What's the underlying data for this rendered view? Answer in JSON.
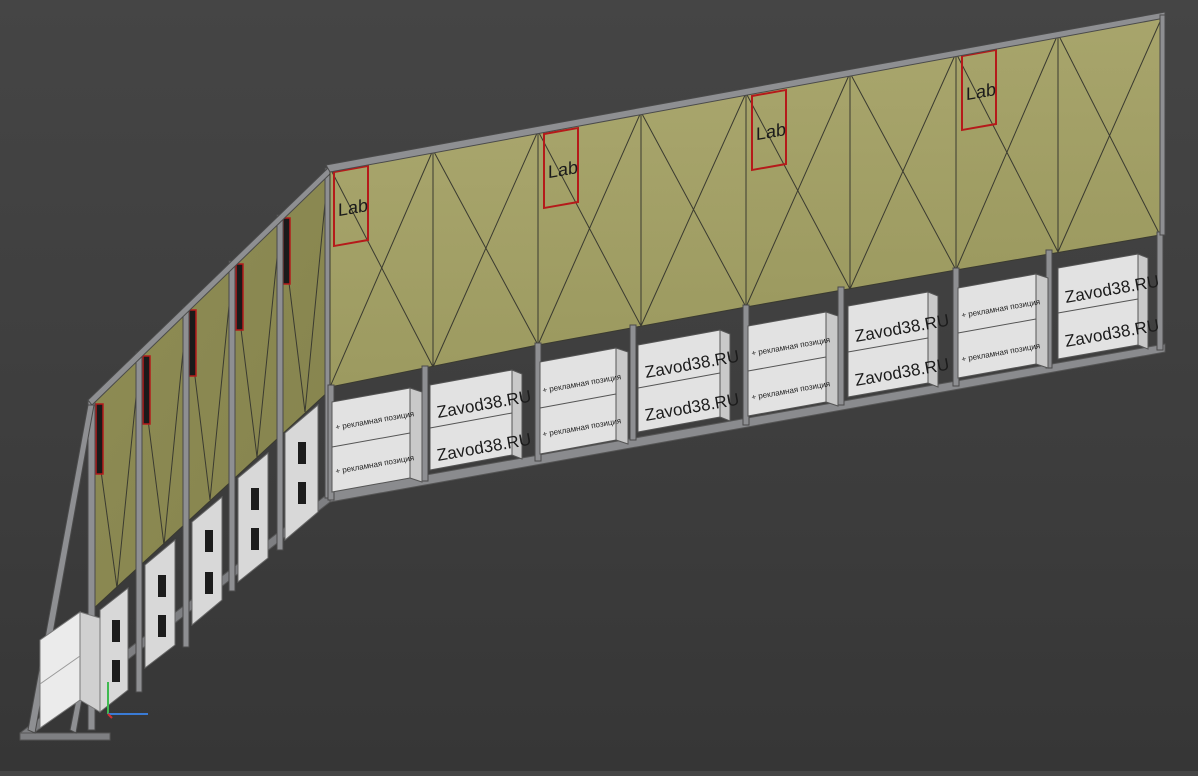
{
  "viewport": {
    "background": "#3f3f3f",
    "panel_color": "#a3a166",
    "frame_color": "#7c7d80",
    "box_color": "#dcdcdc",
    "logo_color": "#b51a1a"
  },
  "logo_text": "Lab",
  "box_labels": {
    "brand": "Zavod38.RU",
    "ad": "+ рекламная позиция"
  },
  "axis_gizmo": {
    "x_color": "#3a7bd5",
    "y_color": "#3fb950"
  }
}
